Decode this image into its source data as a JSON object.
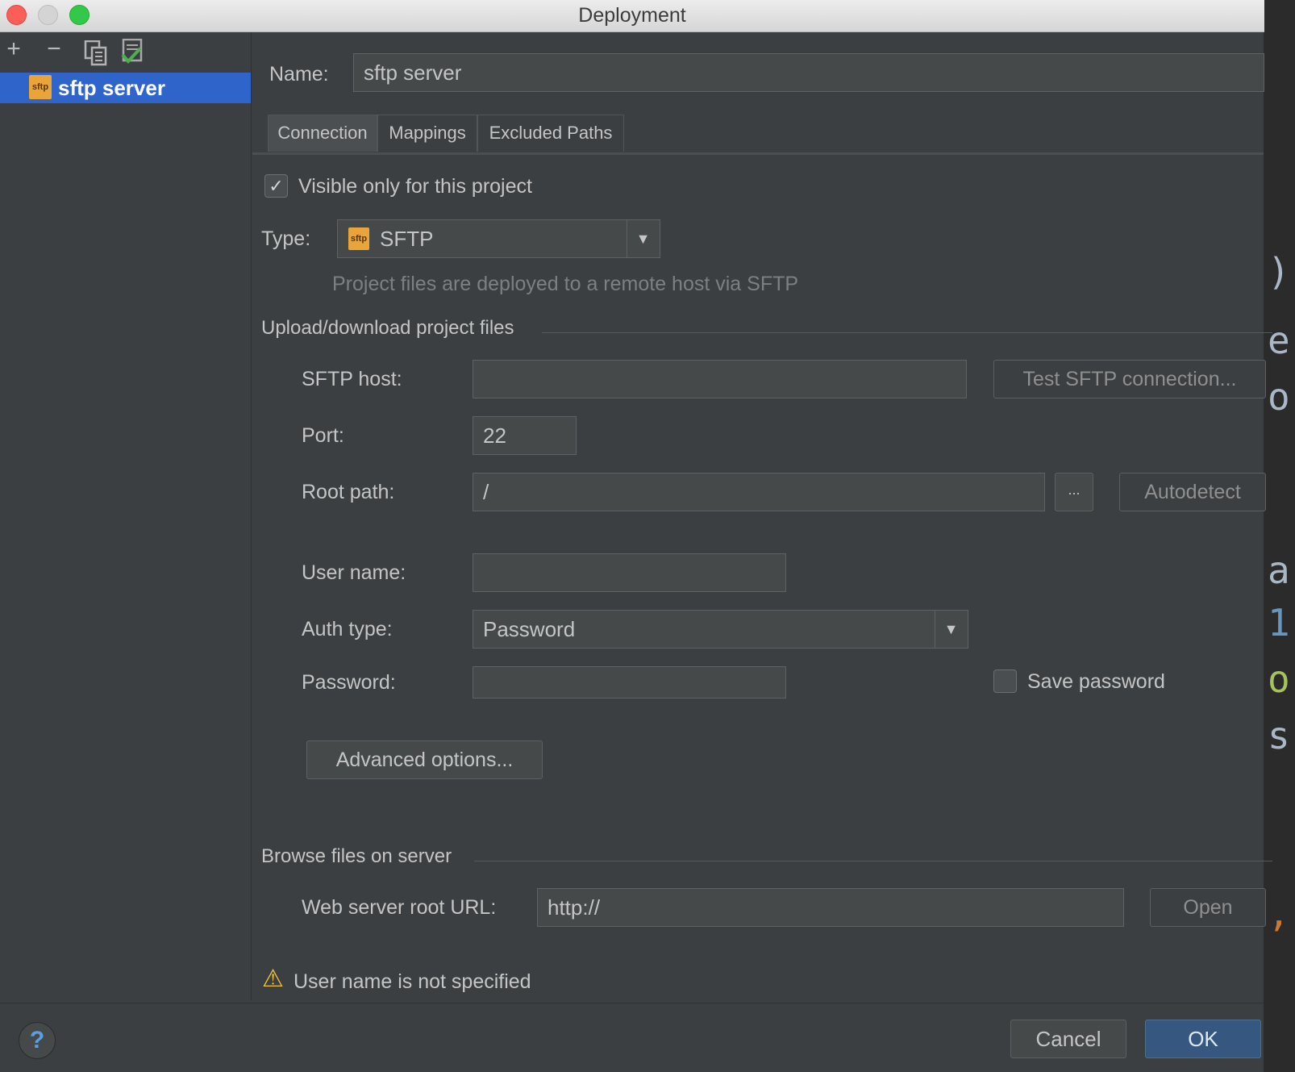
{
  "window": {
    "title": "Deployment"
  },
  "toolbar": {
    "add_icon": "+",
    "remove_icon": "−",
    "copy_icon": "copy-icon",
    "default_icon": "set-default-icon"
  },
  "servers": [
    {
      "label": "sftp server",
      "icon": "sftp"
    }
  ],
  "name_field": {
    "label": "Name:",
    "value": "sftp server"
  },
  "tabs": [
    {
      "label": "Connection"
    },
    {
      "label": "Mappings"
    },
    {
      "label": "Excluded Paths"
    }
  ],
  "visible_only": {
    "label": "Visible only for this project",
    "checked": true,
    "mark": "✓"
  },
  "type": {
    "label": "Type:",
    "icon": "sftp",
    "value": "SFTP",
    "arrow": "▼",
    "description": "Project files are deployed to a remote host via SFTP"
  },
  "upload_section": {
    "title": "Upload/download project files",
    "sftp_host": {
      "label": "SFTP host:",
      "value": ""
    },
    "test_button": "Test SFTP connection...",
    "port": {
      "label": "Port:",
      "value": "22"
    },
    "root_path": {
      "label": "Root path:",
      "value": "/"
    },
    "browse_button": "...",
    "autodetect_button": "Autodetect",
    "user_name": {
      "label": "User name:",
      "value": ""
    },
    "auth_type": {
      "label": "Auth type:",
      "value": "Password",
      "arrow": "▼"
    },
    "password": {
      "label": "Password:",
      "value": ""
    },
    "save_password": {
      "label": "Save password",
      "checked": false
    },
    "advanced_button": "Advanced options..."
  },
  "browse_section": {
    "title": "Browse files on server",
    "web_root": {
      "label": "Web server root URL:",
      "value": "http://"
    },
    "open_button": "Open"
  },
  "warning": {
    "icon": "⚠",
    "text": "User name is not specified"
  },
  "footer": {
    "help_icon": "?",
    "cancel": "Cancel",
    "ok": "OK"
  },
  "colors": {
    "accent": "#2f65ca",
    "ok_button": "#365880",
    "warning": "#f0c33c"
  }
}
